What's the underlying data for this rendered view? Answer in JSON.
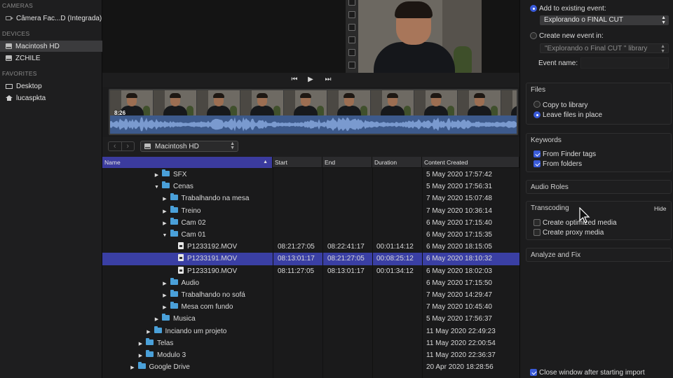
{
  "sidebar": {
    "sections": [
      {
        "header": "CAMERAS",
        "items": [
          {
            "label": "Câmera Fac...D (Integrada)",
            "icon": "camera-icon"
          }
        ]
      },
      {
        "header": "DEVICES",
        "items": [
          {
            "label": "Macintosh HD",
            "icon": "disk-icon",
            "selected": true
          },
          {
            "label": "ZCHILE",
            "icon": "disk-icon"
          }
        ]
      },
      {
        "header": "FAVORITES",
        "items": [
          {
            "label": "Desktop",
            "icon": "desktop-icon"
          },
          {
            "label": "lucaspkta",
            "icon": "home-icon"
          }
        ]
      }
    ]
  },
  "viewer": {
    "transport": {
      "prev": "⏮",
      "play": "▶",
      "next": "⏭"
    }
  },
  "clip": {
    "timecode": "8:26"
  },
  "browser": {
    "back": "‹",
    "forward": "›",
    "location": "Macintosh HD"
  },
  "table": {
    "columns": [
      "Name",
      "Start",
      "End",
      "Duration",
      "Content Created"
    ],
    "sort_indicator": "▲",
    "rows": [
      {
        "indent": 6,
        "disclosure": "▶",
        "type": "folder",
        "name": "SFX",
        "start": "",
        "end": "",
        "duration": "",
        "created": "5 May 2020 17:57:42"
      },
      {
        "indent": 6,
        "disclosure": "▼",
        "type": "folder",
        "name": "Cenas",
        "start": "",
        "end": "",
        "duration": "",
        "created": "5 May 2020 17:56:31"
      },
      {
        "indent": 7,
        "disclosure": "▶",
        "type": "folder",
        "name": "Trabalhando na mesa",
        "start": "",
        "end": "",
        "duration": "",
        "created": "7 May 2020 15:07:48"
      },
      {
        "indent": 7,
        "disclosure": "▶",
        "type": "folder",
        "name": "Treino",
        "start": "",
        "end": "",
        "duration": "",
        "created": "7 May 2020 10:36:14"
      },
      {
        "indent": 7,
        "disclosure": "▶",
        "type": "folder",
        "name": "Cam 02",
        "start": "",
        "end": "",
        "duration": "",
        "created": "6 May 2020 17:15:40"
      },
      {
        "indent": 7,
        "disclosure": "▼",
        "type": "folder",
        "name": "Cam 01",
        "start": "",
        "end": "",
        "duration": "",
        "created": "6 May 2020 17:15:35"
      },
      {
        "indent": 8,
        "disclosure": "",
        "type": "file",
        "name": "P1233192.MOV",
        "start": "08:21:27:05",
        "end": "08:22:41:17",
        "duration": "00:01:14:12",
        "created": "6 May 2020 18:15:05"
      },
      {
        "indent": 8,
        "disclosure": "",
        "type": "file",
        "name": "P1233191.MOV",
        "start": "08:13:01:17",
        "end": "08:21:27:05",
        "duration": "00:08:25:12",
        "created": "6 May 2020 18:10:32",
        "selected": true
      },
      {
        "indent": 8,
        "disclosure": "",
        "type": "file",
        "name": "P1233190.MOV",
        "start": "08:11:27:05",
        "end": "08:13:01:17",
        "duration": "00:01:34:12",
        "created": "6 May 2020 18:02:03"
      },
      {
        "indent": 7,
        "disclosure": "▶",
        "type": "folder",
        "name": "Audio",
        "start": "",
        "end": "",
        "duration": "",
        "created": "6 May 2020 17:15:50"
      },
      {
        "indent": 7,
        "disclosure": "▶",
        "type": "folder",
        "name": "Trabalhando no sofá",
        "start": "",
        "end": "",
        "duration": "",
        "created": "7 May 2020 14:29:47"
      },
      {
        "indent": 7,
        "disclosure": "▶",
        "type": "folder",
        "name": "Mesa com fundo",
        "start": "",
        "end": "",
        "duration": "",
        "created": "7 May 2020 10:45:40"
      },
      {
        "indent": 6,
        "disclosure": "▶",
        "type": "folder",
        "name": "Musica",
        "start": "",
        "end": "",
        "duration": "",
        "created": "5 May 2020 17:56:37"
      },
      {
        "indent": 5,
        "disclosure": "▶",
        "type": "folder",
        "name": "Inciando um projeto",
        "start": "",
        "end": "",
        "duration": "",
        "created": "11 May 2020 22:49:23"
      },
      {
        "indent": 4,
        "disclosure": "▶",
        "type": "folder",
        "name": "Telas",
        "start": "",
        "end": "",
        "duration": "",
        "created": "11 May 2020 22:00:54"
      },
      {
        "indent": 4,
        "disclosure": "▶",
        "type": "folder",
        "name": "Modulo 3",
        "start": "",
        "end": "",
        "duration": "",
        "created": "11 May 2020 22:36:37"
      },
      {
        "indent": 3,
        "disclosure": "▶",
        "type": "folder",
        "name": "Google Drive",
        "start": "",
        "end": "",
        "duration": "",
        "created": "20 Apr 2020 18:28:56"
      }
    ]
  },
  "import_options": {
    "add_existing_label": "Add to existing event:",
    "existing_event_value": "Explorando o FINAL CUT",
    "create_new_label": "Create new event in:",
    "new_event_library": "\"Explorando o Final CUT \" library",
    "event_name_label": "Event name:",
    "files": {
      "title": "Files",
      "copy_label": "Copy to library",
      "leave_label": "Leave files in place"
    },
    "keywords": {
      "title": "Keywords",
      "finder_tags_label": "From Finder tags",
      "folders_label": "From folders"
    },
    "audio_roles_title": "Audio Roles",
    "transcoding": {
      "title": "Transcoding",
      "hide_label": "Hide",
      "optimized_label": "Create optimized media",
      "proxy_label": "Create proxy media"
    },
    "analyze_title": "Analyze and Fix",
    "close_window_label": "Close window after starting import"
  },
  "colors": {
    "accent": "#3a5bd9",
    "selection": "#3a3fa4",
    "folder": "#4aa0d9",
    "waveform": "#3d5a8c"
  }
}
